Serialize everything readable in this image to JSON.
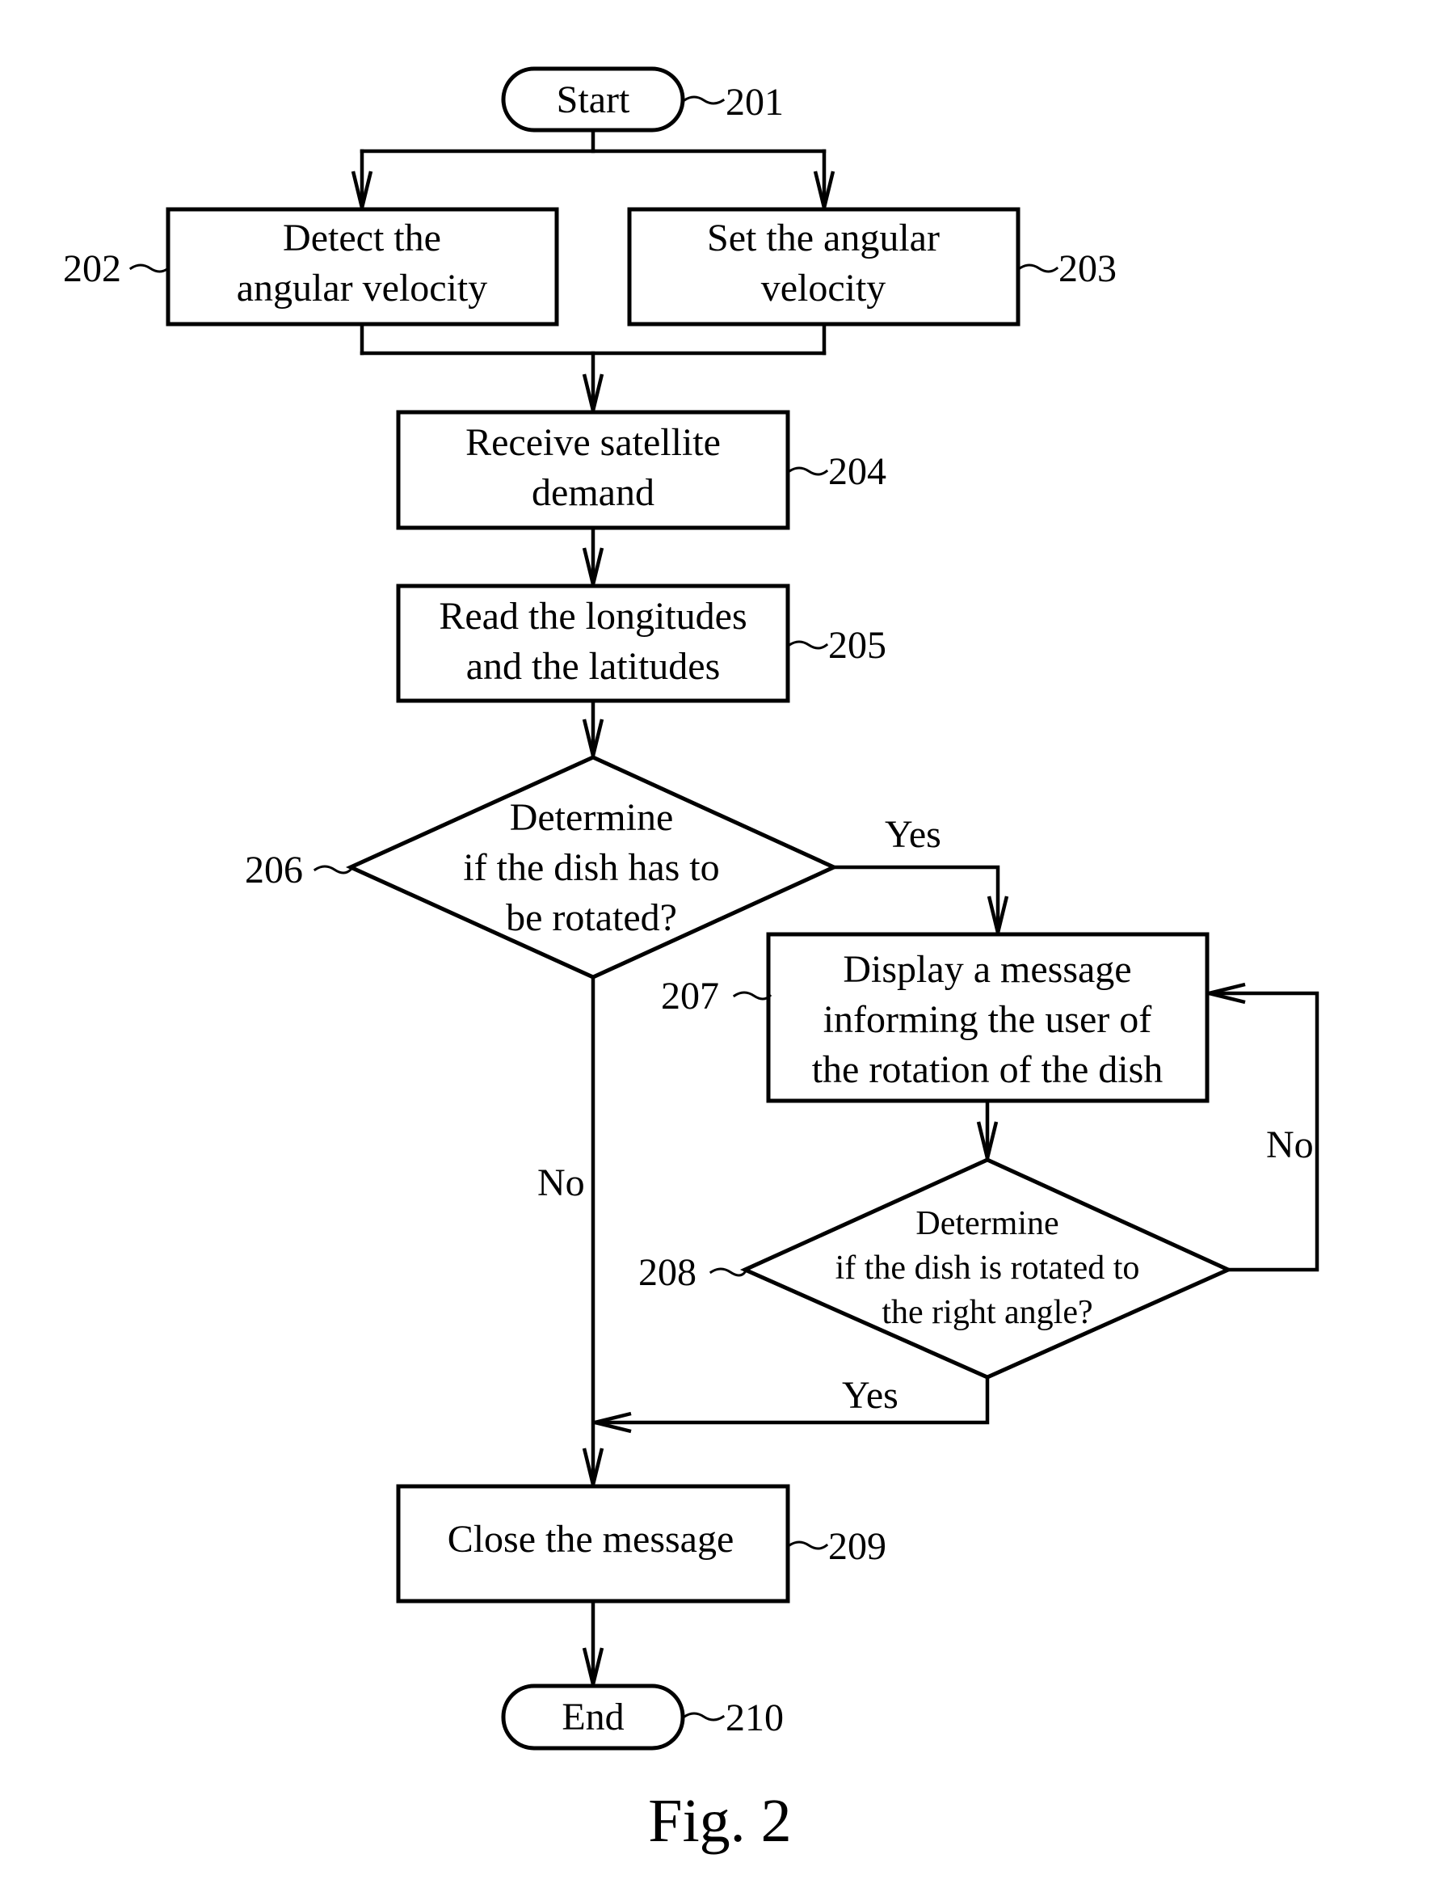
{
  "figure": {
    "caption": "Fig. 2",
    "nodes": [
      {
        "id": "201",
        "type": "terminal",
        "lines": [
          "Start"
        ]
      },
      {
        "id": "202",
        "type": "process",
        "lines": [
          "Detect the",
          "angular velocity"
        ]
      },
      {
        "id": "203",
        "type": "process",
        "lines": [
          "Set the angular",
          "velocity"
        ]
      },
      {
        "id": "204",
        "type": "process",
        "lines": [
          "Receive satellite",
          "demand"
        ]
      },
      {
        "id": "205",
        "type": "process",
        "lines": [
          "Read the longitudes",
          "and the latitudes"
        ]
      },
      {
        "id": "206",
        "type": "decision",
        "lines": [
          "Determine",
          "if the dish has to",
          "be rotated?"
        ]
      },
      {
        "id": "207",
        "type": "process",
        "lines": [
          "Display a message",
          "informing the user of",
          "the rotation of the dish"
        ]
      },
      {
        "id": "208",
        "type": "decision",
        "lines": [
          "Determine",
          "if the dish is rotated to",
          "the right angle?"
        ]
      },
      {
        "id": "209",
        "type": "process",
        "lines": [
          "Close the message"
        ]
      },
      {
        "id": "210",
        "type": "terminal",
        "lines": [
          "End"
        ]
      }
    ],
    "edge_labels": {
      "206_yes": "Yes",
      "206_no": "No",
      "208_no": "No",
      "208_yes": "Yes"
    },
    "refs": {
      "r201": "201",
      "r202": "202",
      "r203": "203",
      "r204": "204",
      "r205": "205",
      "r206": "206",
      "r207": "207",
      "r208": "208",
      "r209": "209",
      "r210": "210"
    }
  }
}
